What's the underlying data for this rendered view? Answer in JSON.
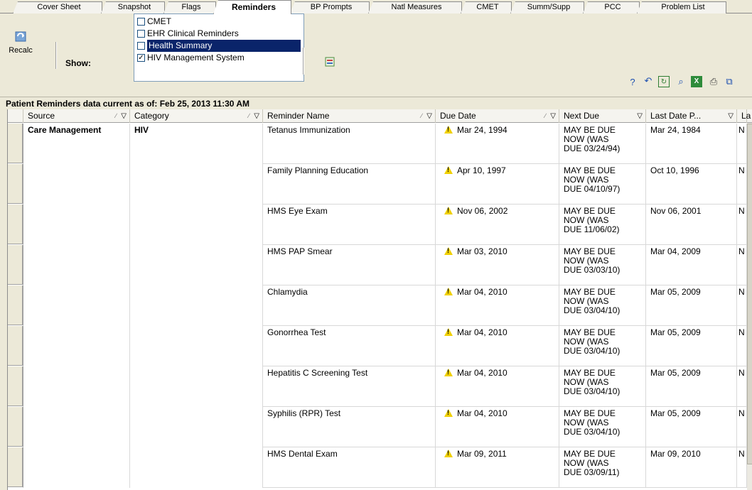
{
  "tabs": [
    "Cover Sheet",
    "Snapshot",
    "Flags",
    "Reminders",
    "BP Prompts",
    "Natl Measures",
    "CMET",
    "Summ/Supp",
    "PCC",
    "Problem List"
  ],
  "active_tab": "Reminders",
  "toolbar": {
    "recalc_label": "Recalc",
    "show_label": "Show:",
    "show_options": [
      {
        "label": "CMET",
        "checked": false,
        "selected": false
      },
      {
        "label": "EHR Clinical Reminders",
        "checked": false,
        "selected": false
      },
      {
        "label": "Health Summary",
        "checked": false,
        "selected": true
      },
      {
        "label": "HIV Management System",
        "checked": true,
        "selected": false
      }
    ],
    "right_icons": [
      "help-icon",
      "undo-icon",
      "refresh-icon",
      "find-icon",
      "excel-icon",
      "print-icon",
      "copy-icon"
    ]
  },
  "status": "Patient Reminders data current as of: Feb 25, 2013 11:30 AM",
  "columns": [
    "Source",
    "Category",
    "Reminder Name",
    "Due Date",
    "Next Due",
    "Last Date P...",
    "La"
  ],
  "group": {
    "source": "Care Management",
    "category": "HIV"
  },
  "rows": [
    {
      "name": "Tetanus Immunization",
      "due": "Mar 24, 1994",
      "next": [
        "MAY BE DUE",
        "NOW (WAS",
        "DUE 03/24/94)"
      ],
      "last": "Mar 24, 1984",
      "la": "N"
    },
    {
      "name": "Family Planning Education",
      "due": "Apr 10, 1997",
      "next": [
        "MAY BE DUE",
        "NOW (WAS",
        "DUE 04/10/97)"
      ],
      "last": "Oct 10, 1996",
      "la": "N"
    },
    {
      "name": "HMS Eye Exam",
      "due": "Nov 06, 2002",
      "next": [
        "MAY BE DUE",
        "NOW (WAS",
        "DUE 11/06/02)"
      ],
      "last": "Nov 06, 2001",
      "la": "N"
    },
    {
      "name": "HMS PAP Smear",
      "due": "Mar 03, 2010",
      "next": [
        "MAY BE DUE",
        "NOW (WAS",
        "DUE 03/03/10)"
      ],
      "last": "Mar 04, 2009",
      "la": "N"
    },
    {
      "name": "Chlamydia",
      "due": "Mar 04, 2010",
      "next": [
        "MAY BE DUE",
        "NOW (WAS",
        "DUE 03/04/10)"
      ],
      "last": "Mar 05, 2009",
      "la": "N"
    },
    {
      "name": "Gonorrhea Test",
      "due": "Mar 04, 2010",
      "next": [
        "MAY BE DUE",
        "NOW (WAS",
        "DUE 03/04/10)"
      ],
      "last": "Mar 05, 2009",
      "la": "N"
    },
    {
      "name": "Hepatitis C Screening Test",
      "due": "Mar 04, 2010",
      "next": [
        "MAY BE DUE",
        "NOW (WAS",
        "DUE 03/04/10)"
      ],
      "last": "Mar 05, 2009",
      "la": "N"
    },
    {
      "name": "Syphilis (RPR) Test",
      "due": "Mar 04, 2010",
      "next": [
        "MAY BE DUE",
        "NOW (WAS",
        "DUE 03/04/10)"
      ],
      "last": "Mar 05, 2009",
      "la": "N"
    },
    {
      "name": "HMS Dental Exam",
      "due": "Mar 09, 2011",
      "next": [
        "MAY BE DUE",
        "NOW (WAS",
        "DUE 03/09/11)"
      ],
      "last": "Mar 09, 2010",
      "la": "N"
    }
  ]
}
